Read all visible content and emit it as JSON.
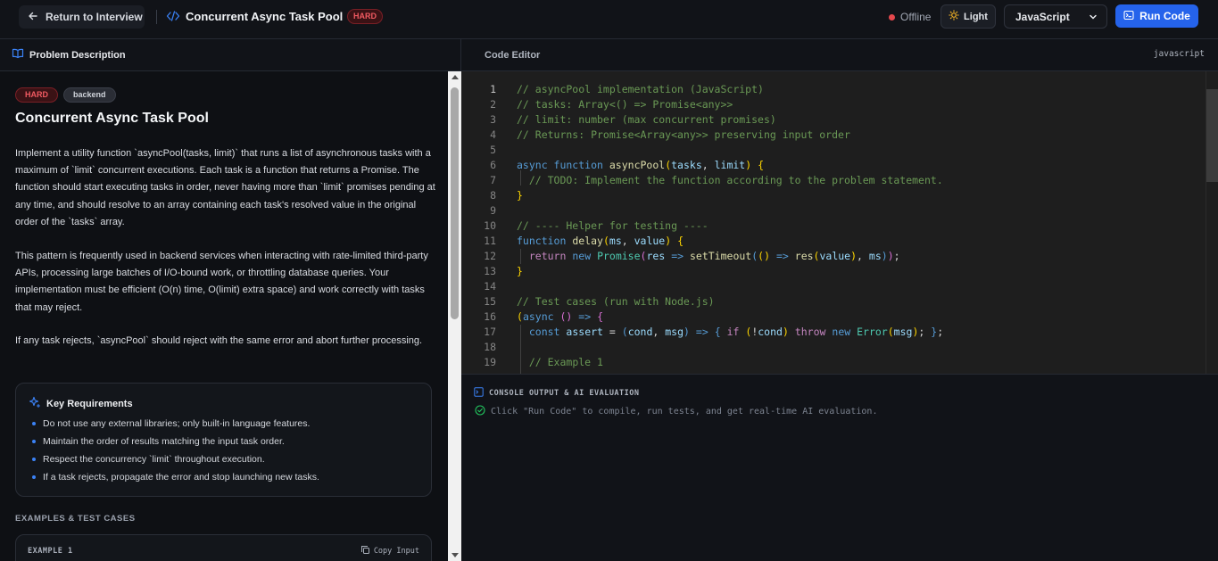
{
  "header": {
    "back_label": "Return to Interview",
    "title": "Concurrent Async Task Pool",
    "difficulty": "HARD",
    "status": "Offline",
    "theme_label": "Light",
    "language": "JavaScript",
    "run_label": "Run Code"
  },
  "problem": {
    "panel_title": "Problem Description",
    "difficulty": "HARD",
    "tag": "backend",
    "title": "Concurrent Async Task Pool",
    "paragraphs": [
      "Implement a utility function `asyncPool(tasks, limit)` that runs a list of asynchronous tasks with a maximum of `limit` concurrent executions. Each task is a function that returns a Promise. The function should start executing tasks in order, never having more than `limit` promises pending at any time, and should resolve to an array containing each task's resolved value in the original order of the `tasks` array.",
      "This pattern is frequently used in backend services when interacting with rate-limited third-party APIs, processing large batches of I/O-bound work, or throttling database queries. Your implementation must be efficient (O(n) time, O(limit) extra space) and work correctly with tasks that may reject.",
      "If any task rejects, `asyncPool` should reject with the same error and abort further processing."
    ],
    "requirements_title": "Key Requirements",
    "requirements": [
      "Do not use any external libraries; only built-in language features.",
      "Maintain the order of results matching the input task order.",
      "Respect the concurrency `limit` throughout execution.",
      "If a task rejects, propagate the error and stop launching new tasks."
    ],
    "examples_heading": "EXAMPLES & TEST CASES",
    "example_label": "EXAMPLE 1",
    "copy_label": "Copy Input"
  },
  "editor": {
    "title": "Code Editor",
    "language_label": "javascript",
    "line_numbers": [
      "1",
      "2",
      "3",
      "4",
      "5",
      "6",
      "7",
      "8",
      "9",
      "10",
      "11",
      "12",
      "13",
      "14",
      "15",
      "16",
      "17",
      "18",
      "19"
    ]
  },
  "console": {
    "title": "CONSOLE OUTPUT & AI EVALUATION",
    "message": "Click \"Run Code\" to compile, run tests, and get real-time AI evaluation."
  },
  "colors": {
    "accent": "#2563eb",
    "hard": "#f05a61",
    "offline": "#e5484d"
  }
}
